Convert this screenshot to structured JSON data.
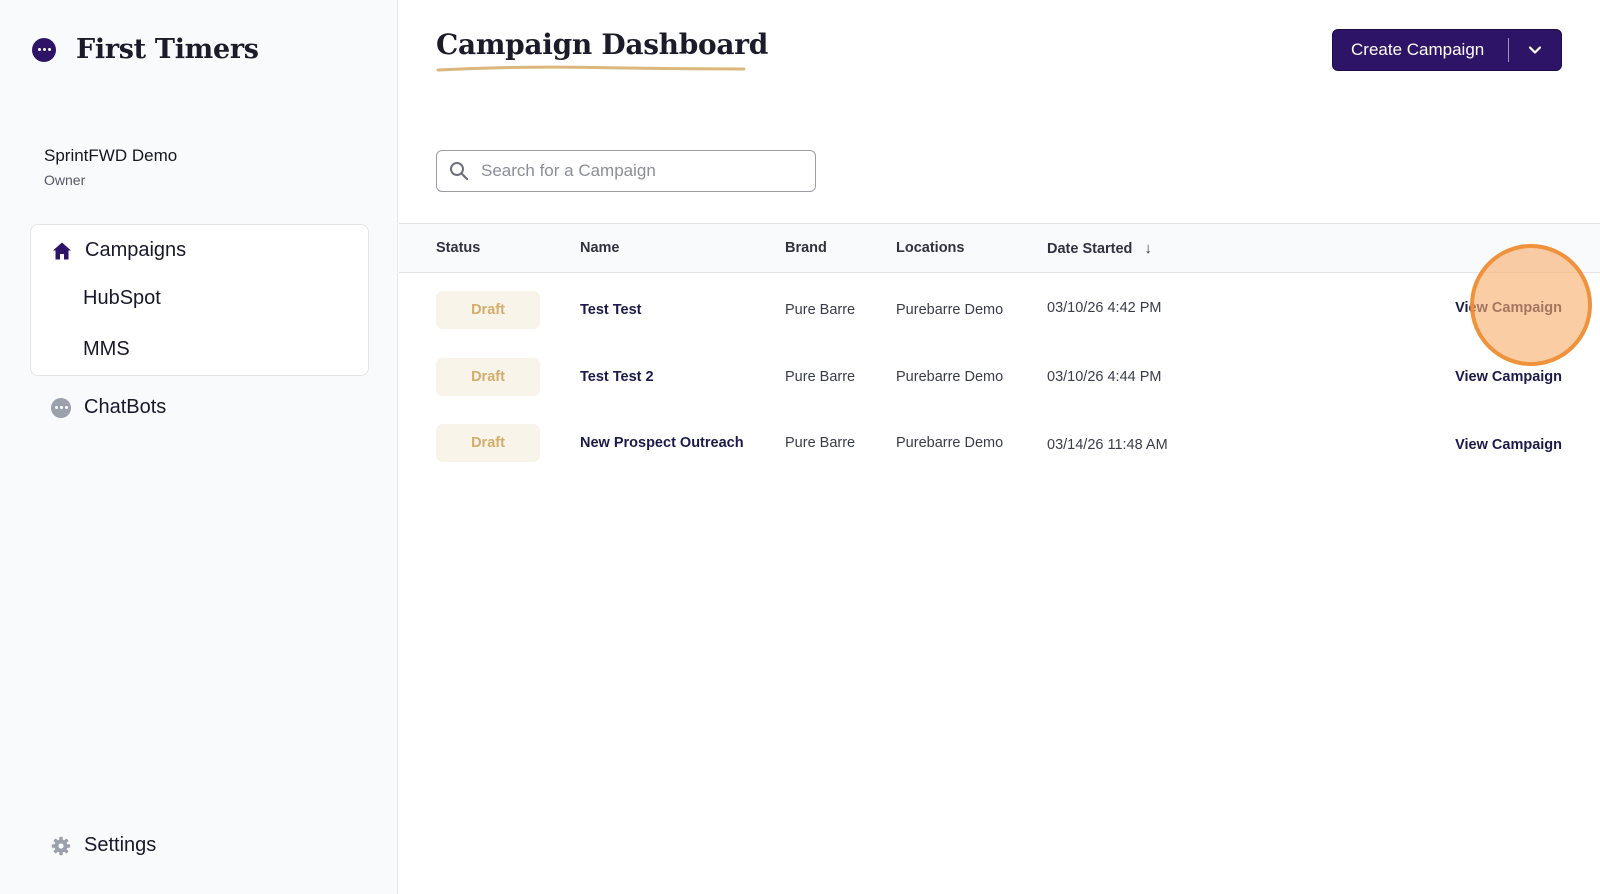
{
  "brand": {
    "name": "First Timers"
  },
  "account": {
    "name": "SprintFWD Demo",
    "role": "Owner"
  },
  "sidebar": {
    "items": [
      {
        "label": "Campaigns",
        "icon": "home-icon",
        "active": true
      },
      {
        "label": "HubSpot"
      },
      {
        "label": "MMS"
      },
      {
        "label": "ChatBots",
        "icon": "chat-bubble-icon"
      },
      {
        "label": "Settings",
        "icon": "gear-icon"
      }
    ]
  },
  "header": {
    "title": "Campaign Dashboard",
    "create_button": "Create Campaign"
  },
  "search": {
    "placeholder": "Search for a Campaign",
    "value": ""
  },
  "table": {
    "columns": [
      "Status",
      "Name",
      "Brand",
      "Locations",
      "Date Started"
    ],
    "sort_indicator": "↓",
    "rows": [
      {
        "status": "Draft",
        "name": "Test Test",
        "brand": "Pure Barre",
        "location": "Purebarre Demo",
        "date": "03/10/26 4:42 PM",
        "action": "View Campaign"
      },
      {
        "status": "Draft",
        "name": "Test Test 2",
        "brand": "Pure Barre",
        "location": "Purebarre Demo",
        "date": "03/10/26 4:44 PM",
        "action": "View Campaign"
      },
      {
        "status": "Draft",
        "name": "New Prospect Outreach",
        "brand": "Pure Barre",
        "location": "Purebarre Demo",
        "date": "03/14/26 11:48 AM",
        "action": "View Campaign"
      }
    ]
  },
  "colors": {
    "accent": "#2d1466",
    "draft_badge_bg": "#f8f4ea",
    "draft_badge_text": "#d3ad6b",
    "title_underline": "#dcb77c",
    "click_highlight": "#f59e50"
  }
}
